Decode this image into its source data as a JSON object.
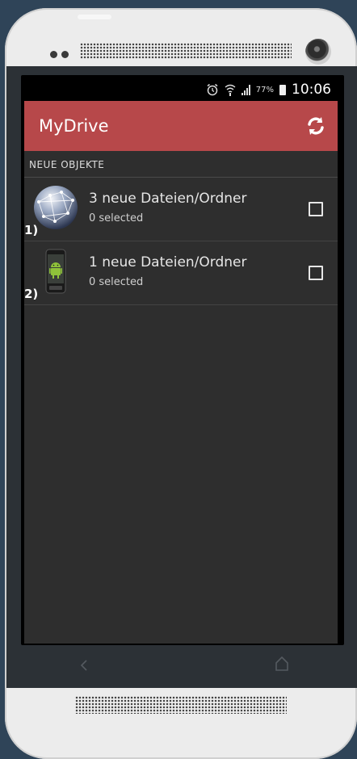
{
  "status_bar": {
    "battery_percent": "77%",
    "time": "10:06"
  },
  "app_bar": {
    "title": "MyDrive",
    "refresh_icon": "refresh-icon"
  },
  "section": {
    "header": "NEUE OBJEKTE"
  },
  "items": [
    {
      "number": "1)",
      "title": "3 neue Dateien/Ordner",
      "subtitle": "0 selected",
      "icon": "globe-network-icon"
    },
    {
      "number": "2)",
      "title": "1 neue Dateien/Ordner",
      "subtitle": "0 selected",
      "icon": "android-phone-icon"
    }
  ],
  "colors": {
    "accent": "#b7484a",
    "background": "#2e2e2e",
    "outer": "#2f4458"
  }
}
